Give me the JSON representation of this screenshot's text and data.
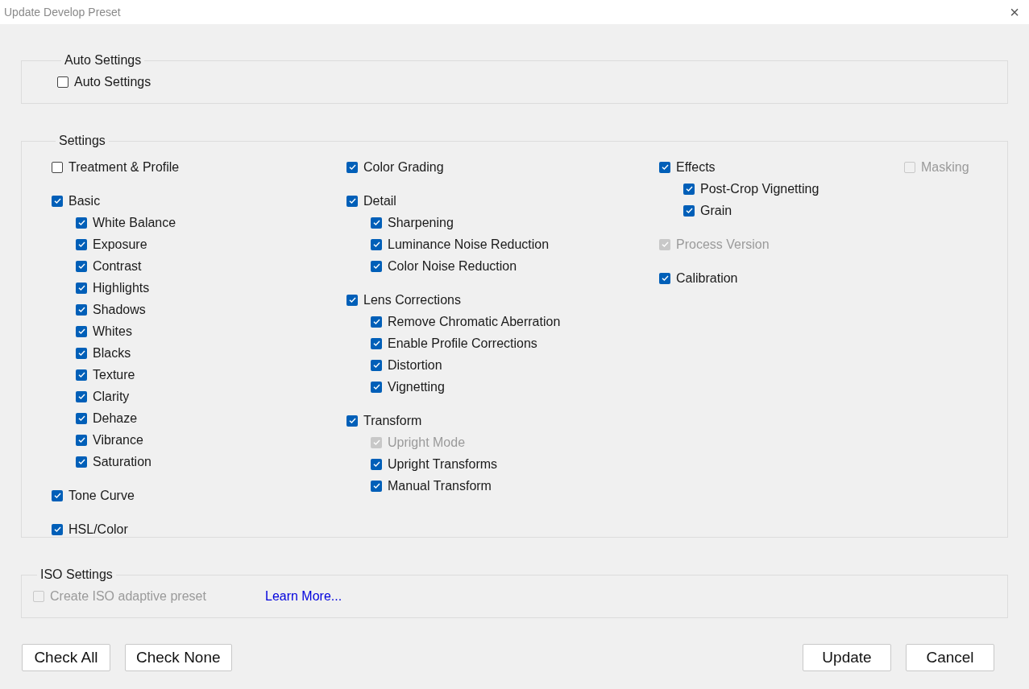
{
  "window": {
    "title": "Update Develop Preset",
    "close": "×"
  },
  "auto_settings": {
    "legend": "Auto Settings",
    "checkbox": {
      "label": "Auto Settings",
      "checked": false,
      "disabled": false
    }
  },
  "settings": {
    "legend": "Settings",
    "columns": [
      [
        {
          "label": "Treatment & Profile",
          "checked": false,
          "disabled": false
        },
        {
          "label": "Basic",
          "checked": true,
          "disabled": false,
          "children": [
            {
              "label": "White Balance",
              "checked": true,
              "disabled": false
            },
            {
              "label": "Exposure",
              "checked": true,
              "disabled": false
            },
            {
              "label": "Contrast",
              "checked": true,
              "disabled": false
            },
            {
              "label": "Highlights",
              "checked": true,
              "disabled": false
            },
            {
              "label": "Shadows",
              "checked": true,
              "disabled": false
            },
            {
              "label": "Whites",
              "checked": true,
              "disabled": false
            },
            {
              "label": "Blacks",
              "checked": true,
              "disabled": false
            },
            {
              "label": "Texture",
              "checked": true,
              "disabled": false
            },
            {
              "label": "Clarity",
              "checked": true,
              "disabled": false
            },
            {
              "label": "Dehaze",
              "checked": true,
              "disabled": false
            },
            {
              "label": "Vibrance",
              "checked": true,
              "disabled": false
            },
            {
              "label": "Saturation",
              "checked": true,
              "disabled": false
            }
          ]
        },
        {
          "label": "Tone Curve",
          "checked": true,
          "disabled": false
        },
        {
          "label": "HSL/Color",
          "checked": true,
          "disabled": false
        }
      ],
      [
        {
          "label": "Color Grading",
          "checked": true,
          "disabled": false
        },
        {
          "label": "Detail",
          "checked": true,
          "disabled": false,
          "children": [
            {
              "label": "Sharpening",
              "checked": true,
              "disabled": false
            },
            {
              "label": "Luminance Noise Reduction",
              "checked": true,
              "disabled": false
            },
            {
              "label": "Color Noise Reduction",
              "checked": true,
              "disabled": false
            }
          ]
        },
        {
          "label": "Lens Corrections",
          "checked": true,
          "disabled": false,
          "children": [
            {
              "label": "Remove Chromatic Aberration",
              "checked": true,
              "disabled": false
            },
            {
              "label": "Enable Profile Corrections",
              "checked": true,
              "disabled": false
            },
            {
              "label": "Distortion",
              "checked": true,
              "disabled": false
            },
            {
              "label": "Vignetting",
              "checked": true,
              "disabled": false
            }
          ]
        },
        {
          "label": "Transform",
          "checked": true,
          "disabled": false,
          "children": [
            {
              "label": "Upright Mode",
              "checked": true,
              "disabled": true
            },
            {
              "label": "Upright Transforms",
              "checked": true,
              "disabled": false
            },
            {
              "label": "Manual Transform",
              "checked": true,
              "disabled": false
            }
          ]
        }
      ],
      [
        {
          "label": "Effects",
          "checked": true,
          "disabled": false,
          "children": [
            {
              "label": "Post-Crop Vignetting",
              "checked": true,
              "disabled": false
            },
            {
              "label": "Grain",
              "checked": true,
              "disabled": false
            }
          ]
        },
        {
          "label": "Process Version",
          "checked": true,
          "disabled": true
        },
        {
          "label": "Calibration",
          "checked": true,
          "disabled": false
        }
      ],
      [
        {
          "label": "Masking",
          "checked": false,
          "disabled": true
        }
      ]
    ]
  },
  "iso_settings": {
    "legend": "ISO Settings",
    "checkbox": {
      "label": "Create ISO adaptive preset",
      "checked": false,
      "disabled": true
    },
    "link": "Learn More..."
  },
  "buttons_left": [
    "Check All",
    "Check None"
  ],
  "buttons_right": [
    "Update",
    "Cancel"
  ]
}
